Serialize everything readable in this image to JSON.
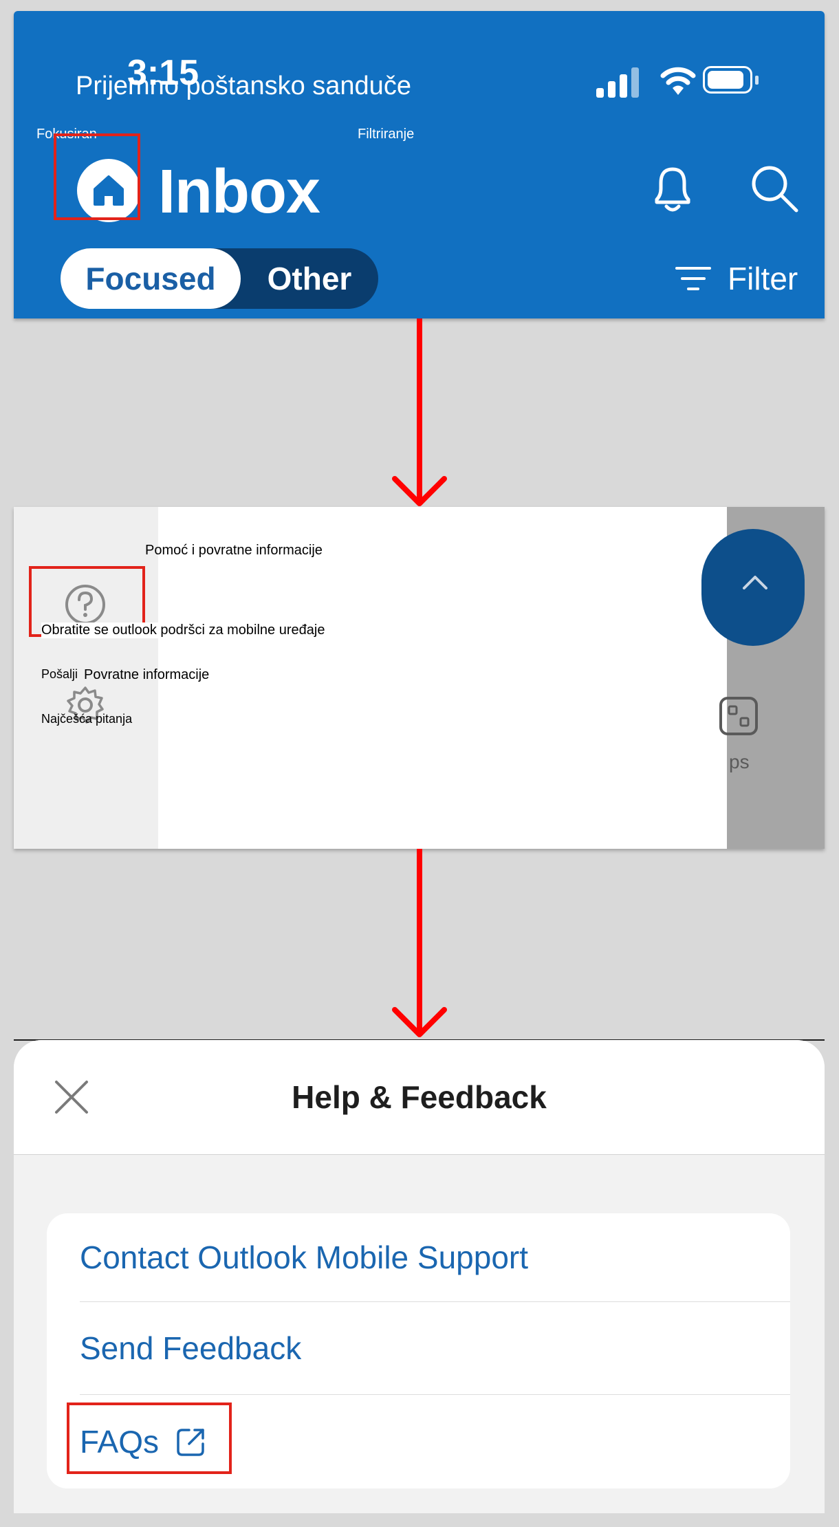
{
  "inbox_screen": {
    "status_time": "3:15",
    "mailbox_overlay": "Prijemno poštansko sanduče",
    "focused_overlay": "Fokusiran",
    "filter_overlay": "Filtriranje",
    "title": "Inbox",
    "tab_focused": "Focused",
    "tab_other": "Other",
    "filter_label": "Filter",
    "icons": [
      "signal-icon",
      "wifi-icon",
      "battery-icon",
      "home-icon",
      "bell-icon",
      "search-icon",
      "filter-icon"
    ],
    "colors": {
      "header_bg": "#1170c1",
      "segment_dark": "#0a3d6e",
      "highlight": "#e2231a"
    }
  },
  "side_menu": {
    "heading": "Pomoć i povratne informacije",
    "contact_support": "Obratite se outlook podršci za mobilne uređaje",
    "send_prefix": "Pošalji",
    "send_feedback": "Povratne informacije",
    "faq": "Najčešća pitanja",
    "dimmed_fragment": "ps",
    "icons": [
      "help-circle-icon",
      "settings-gear-icon",
      "apps-grid-icon"
    ]
  },
  "help_sheet": {
    "title": "Help & Feedback",
    "items": [
      {
        "label": "Contact Outlook Mobile Support"
      },
      {
        "label": "Send Feedback"
      },
      {
        "label": "FAQs"
      }
    ],
    "icons": [
      "close-icon",
      "external-link-icon"
    ],
    "colors": {
      "link": "#1a66b0"
    }
  }
}
